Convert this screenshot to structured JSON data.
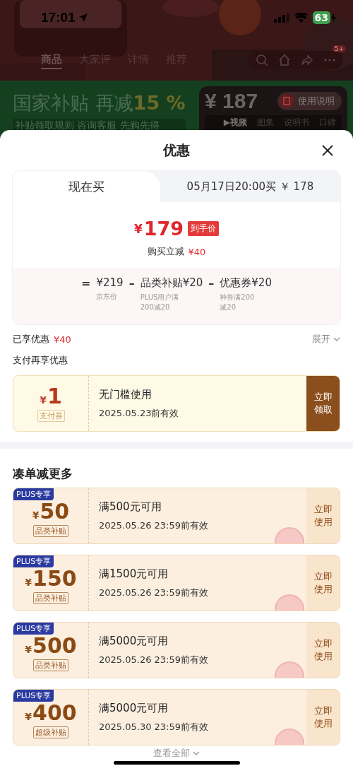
{
  "status_bar": {
    "time": "17:01",
    "battery": "63"
  },
  "product_nav": {
    "tabs": [
      {
        "label": "商品",
        "selected": true
      },
      {
        "label": "大家评",
        "selected": false
      },
      {
        "label": "详情",
        "selected": false
      },
      {
        "label": "推荐",
        "selected": false
      }
    ],
    "more_badge": "5+"
  },
  "banner": {
    "title": "国家补贴 再减",
    "highlight": "15 %",
    "subtitle": "补贴领取规则 咨询客服 先购先得",
    "guide_button": "使用说明",
    "price_currency": "¥",
    "price": "187",
    "media_tabs": [
      {
        "label": "▶视频",
        "selected": true
      },
      {
        "label": "图集",
        "selected": false
      },
      {
        "label": "说明书",
        "selected": false
      },
      {
        "label": "口碑",
        "selected": false
      }
    ]
  },
  "sheet": {
    "title": "优惠",
    "buy_tabs": [
      {
        "label": "现在买",
        "selected": true
      },
      {
        "label": "05月17日20:00买 ￥ 178",
        "selected": false
      }
    ],
    "final_price": {
      "currency": "¥",
      "amount": "179",
      "tag": "到手价"
    },
    "instant_cut": {
      "label": "购买立减",
      "amount": "¥40"
    },
    "formula": [
      {
        "op": "=",
        "value": "¥219",
        "note": "京东价"
      },
      {
        "op": "–",
        "value": "品类补贴¥20",
        "note": "PLUS用户满200减20"
      },
      {
        "op": "–",
        "value": "优惠券¥20",
        "note": "神券满200减20"
      }
    ],
    "enjoyed": {
      "label": "已享优惠",
      "amount": "¥40",
      "toggle": "展开"
    },
    "pay_title": "支付再享优惠",
    "pay_coupons": [
      {
        "kind": "pay",
        "currency": "¥",
        "amount": "1",
        "tag": "支付券",
        "condition": "无门槛使用",
        "validity": "2025.05.23前有效",
        "action": "立即领取"
      }
    ],
    "more_title": "凑单减更多",
    "more_coupons": [
      {
        "kind": "plus",
        "badge": "PLUS专享",
        "currency": "¥",
        "amount": "50",
        "tag": "品类补贴",
        "condition": "满500元可用",
        "validity": "2025.05.26 23:59前有效",
        "action": "立即使用"
      },
      {
        "kind": "plus",
        "badge": "PLUS专享",
        "currency": "¥",
        "amount": "150",
        "tag": "品类补贴",
        "condition": "满1500元可用",
        "validity": "2025.05.26 23:59前有效",
        "action": "立即使用"
      },
      {
        "kind": "plus",
        "badge": "PLUS专享",
        "currency": "¥",
        "amount": "500",
        "tag": "品类补贴",
        "condition": "满5000元可用",
        "validity": "2025.05.26 23:59前有效",
        "action": "立即使用"
      },
      {
        "kind": "plus",
        "badge": "PLUS专享",
        "currency": "¥",
        "amount": "400",
        "tag": "超级补贴",
        "condition": "满5000元可用",
        "validity": "2025.05.30 23:59前有效",
        "action": "立即使用"
      }
    ],
    "view_all": "查看全部"
  }
}
